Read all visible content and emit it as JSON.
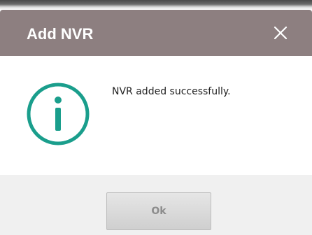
{
  "dialog": {
    "title": "Add NVR",
    "close_icon": "close-icon",
    "message": "NVR added successfully.",
    "info_icon": "info-icon",
    "ok_label": "Ok"
  },
  "colors": {
    "titlebar": "#8d7f80",
    "title_text": "#ffffff",
    "info_icon": "#1a9e8c",
    "footer": "#f0f0f0",
    "button_text": "#8c8c8c"
  }
}
